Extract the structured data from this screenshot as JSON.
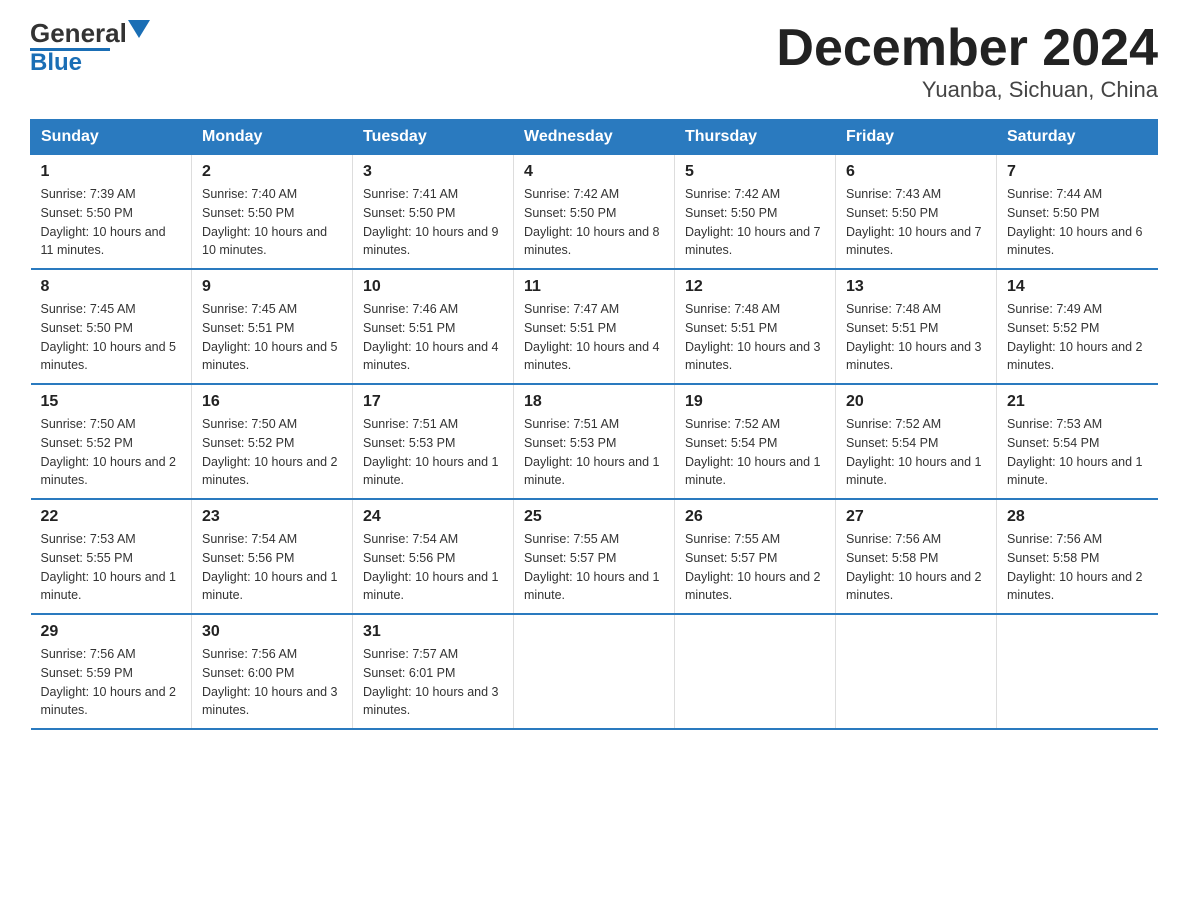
{
  "header": {
    "logo_general": "General",
    "logo_blue": "Blue",
    "title": "December 2024",
    "subtitle": "Yuanba, Sichuan, China"
  },
  "weekdays": [
    "Sunday",
    "Monday",
    "Tuesday",
    "Wednesday",
    "Thursday",
    "Friday",
    "Saturday"
  ],
  "weeks": [
    [
      {
        "day": "1",
        "sunrise": "7:39 AM",
        "sunset": "5:50 PM",
        "daylight": "10 hours and 11 minutes."
      },
      {
        "day": "2",
        "sunrise": "7:40 AM",
        "sunset": "5:50 PM",
        "daylight": "10 hours and 10 minutes."
      },
      {
        "day": "3",
        "sunrise": "7:41 AM",
        "sunset": "5:50 PM",
        "daylight": "10 hours and 9 minutes."
      },
      {
        "day": "4",
        "sunrise": "7:42 AM",
        "sunset": "5:50 PM",
        "daylight": "10 hours and 8 minutes."
      },
      {
        "day": "5",
        "sunrise": "7:42 AM",
        "sunset": "5:50 PM",
        "daylight": "10 hours and 7 minutes."
      },
      {
        "day": "6",
        "sunrise": "7:43 AM",
        "sunset": "5:50 PM",
        "daylight": "10 hours and 7 minutes."
      },
      {
        "day": "7",
        "sunrise": "7:44 AM",
        "sunset": "5:50 PM",
        "daylight": "10 hours and 6 minutes."
      }
    ],
    [
      {
        "day": "8",
        "sunrise": "7:45 AM",
        "sunset": "5:50 PM",
        "daylight": "10 hours and 5 minutes."
      },
      {
        "day": "9",
        "sunrise": "7:45 AM",
        "sunset": "5:51 PM",
        "daylight": "10 hours and 5 minutes."
      },
      {
        "day": "10",
        "sunrise": "7:46 AM",
        "sunset": "5:51 PM",
        "daylight": "10 hours and 4 minutes."
      },
      {
        "day": "11",
        "sunrise": "7:47 AM",
        "sunset": "5:51 PM",
        "daylight": "10 hours and 4 minutes."
      },
      {
        "day": "12",
        "sunrise": "7:48 AM",
        "sunset": "5:51 PM",
        "daylight": "10 hours and 3 minutes."
      },
      {
        "day": "13",
        "sunrise": "7:48 AM",
        "sunset": "5:51 PM",
        "daylight": "10 hours and 3 minutes."
      },
      {
        "day": "14",
        "sunrise": "7:49 AM",
        "sunset": "5:52 PM",
        "daylight": "10 hours and 2 minutes."
      }
    ],
    [
      {
        "day": "15",
        "sunrise": "7:50 AM",
        "sunset": "5:52 PM",
        "daylight": "10 hours and 2 minutes."
      },
      {
        "day": "16",
        "sunrise": "7:50 AM",
        "sunset": "5:52 PM",
        "daylight": "10 hours and 2 minutes."
      },
      {
        "day": "17",
        "sunrise": "7:51 AM",
        "sunset": "5:53 PM",
        "daylight": "10 hours and 1 minute."
      },
      {
        "day": "18",
        "sunrise": "7:51 AM",
        "sunset": "5:53 PM",
        "daylight": "10 hours and 1 minute."
      },
      {
        "day": "19",
        "sunrise": "7:52 AM",
        "sunset": "5:54 PM",
        "daylight": "10 hours and 1 minute."
      },
      {
        "day": "20",
        "sunrise": "7:52 AM",
        "sunset": "5:54 PM",
        "daylight": "10 hours and 1 minute."
      },
      {
        "day": "21",
        "sunrise": "7:53 AM",
        "sunset": "5:54 PM",
        "daylight": "10 hours and 1 minute."
      }
    ],
    [
      {
        "day": "22",
        "sunrise": "7:53 AM",
        "sunset": "5:55 PM",
        "daylight": "10 hours and 1 minute."
      },
      {
        "day": "23",
        "sunrise": "7:54 AM",
        "sunset": "5:56 PM",
        "daylight": "10 hours and 1 minute."
      },
      {
        "day": "24",
        "sunrise": "7:54 AM",
        "sunset": "5:56 PM",
        "daylight": "10 hours and 1 minute."
      },
      {
        "day": "25",
        "sunrise": "7:55 AM",
        "sunset": "5:57 PM",
        "daylight": "10 hours and 1 minute."
      },
      {
        "day": "26",
        "sunrise": "7:55 AM",
        "sunset": "5:57 PM",
        "daylight": "10 hours and 2 minutes."
      },
      {
        "day": "27",
        "sunrise": "7:56 AM",
        "sunset": "5:58 PM",
        "daylight": "10 hours and 2 minutes."
      },
      {
        "day": "28",
        "sunrise": "7:56 AM",
        "sunset": "5:58 PM",
        "daylight": "10 hours and 2 minutes."
      }
    ],
    [
      {
        "day": "29",
        "sunrise": "7:56 AM",
        "sunset": "5:59 PM",
        "daylight": "10 hours and 2 minutes."
      },
      {
        "day": "30",
        "sunrise": "7:56 AM",
        "sunset": "6:00 PM",
        "daylight": "10 hours and 3 minutes."
      },
      {
        "day": "31",
        "sunrise": "7:57 AM",
        "sunset": "6:01 PM",
        "daylight": "10 hours and 3 minutes."
      },
      {
        "day": "",
        "sunrise": "",
        "sunset": "",
        "daylight": ""
      },
      {
        "day": "",
        "sunrise": "",
        "sunset": "",
        "daylight": ""
      },
      {
        "day": "",
        "sunrise": "",
        "sunset": "",
        "daylight": ""
      },
      {
        "day": "",
        "sunrise": "",
        "sunset": "",
        "daylight": ""
      }
    ]
  ]
}
